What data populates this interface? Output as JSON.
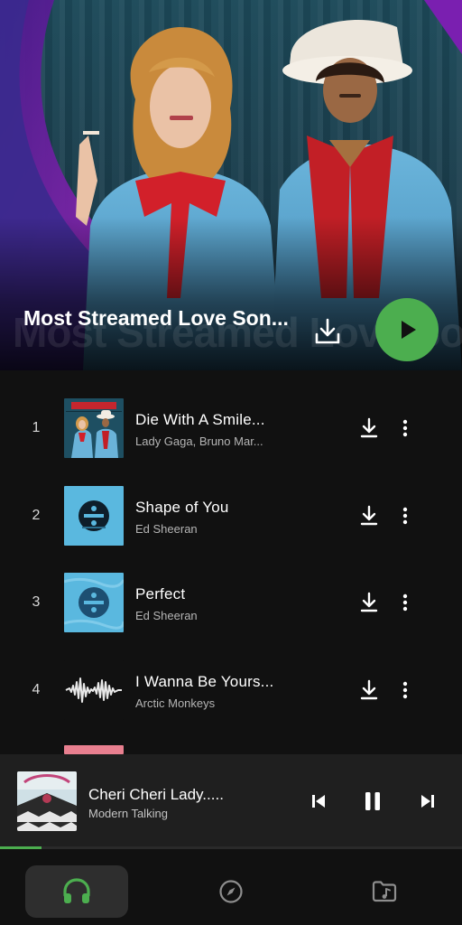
{
  "playlist": {
    "title": "Most Streamed Love Son...",
    "ghost_title": "Most Streamed Love Songs"
  },
  "tracks": [
    {
      "index": "1",
      "title": "Die With A Smile...",
      "artist": "Lady Gaga, Bruno Mar...",
      "art": "duo-cover"
    },
    {
      "index": "2",
      "title": "Shape of You",
      "artist": "Ed Sheeran",
      "art": "divide-cover"
    },
    {
      "index": "3",
      "title": "Perfect",
      "artist": "Ed Sheeran",
      "art": "divide-cover"
    },
    {
      "index": "4",
      "title": "I Wanna Be Yours...",
      "artist": "Arctic Monkeys",
      "art": "waveform-cover"
    }
  ],
  "now_playing": {
    "title": "Cheri Cheri Lady.....",
    "artist": "Modern Talking",
    "progress": 0.09
  },
  "nav": [
    {
      "name": "headphones-icon",
      "active": true
    },
    {
      "name": "compass-icon",
      "active": false
    },
    {
      "name": "music-folder-icon",
      "active": false
    }
  ],
  "colors": {
    "accent": "#4cae4f",
    "background": "#111111",
    "player_bar": "#1f1f1f",
    "hero_purple": "#7a1fb0",
    "divide_blue": "#5ab8df"
  }
}
